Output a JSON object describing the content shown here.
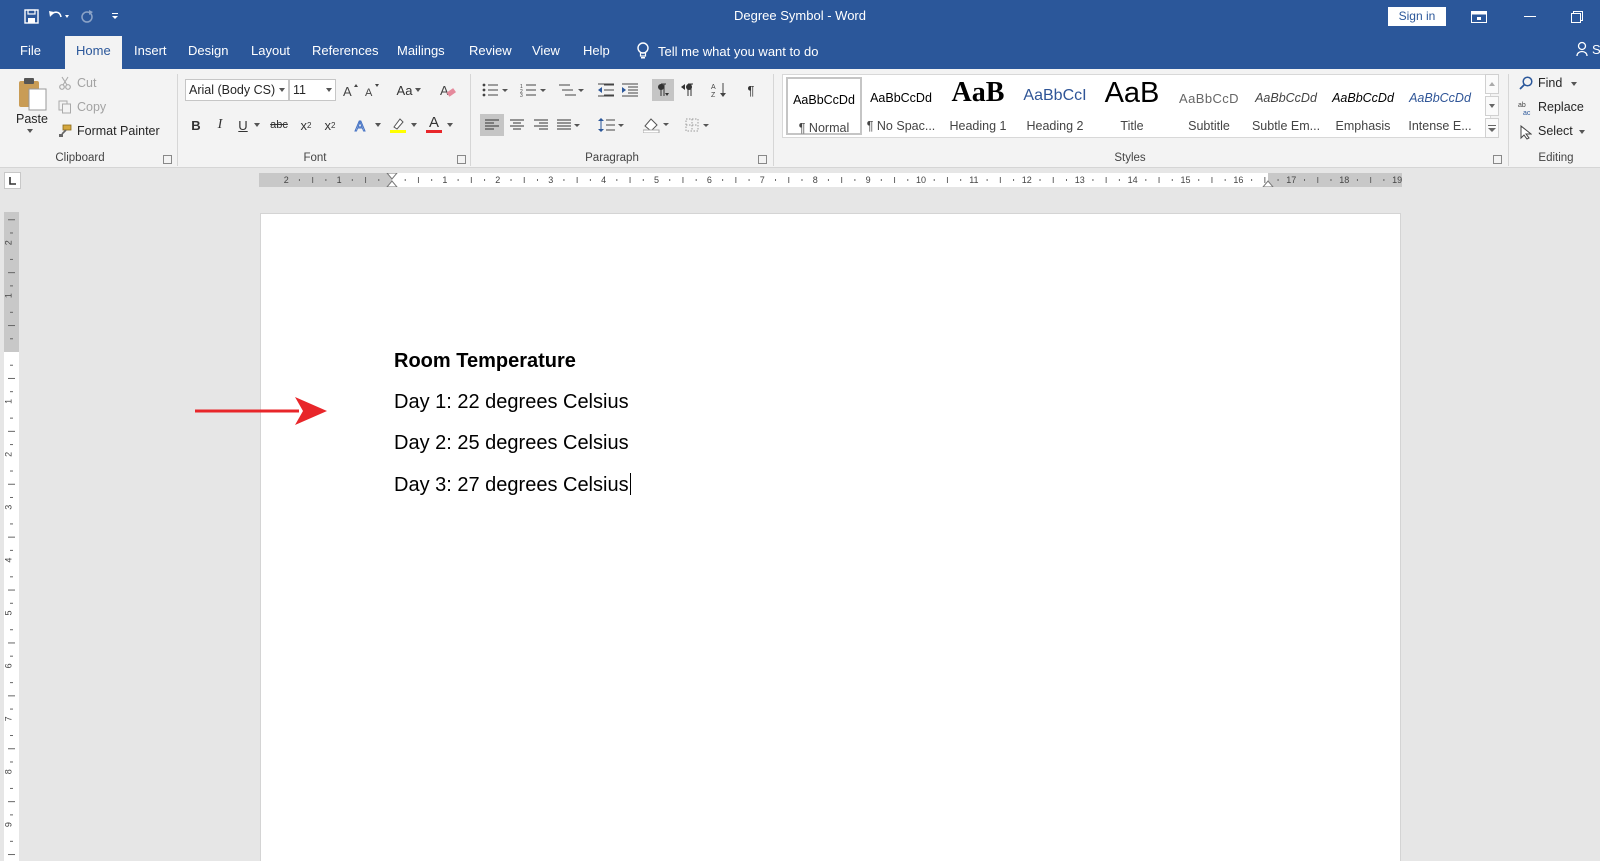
{
  "title_bar": {
    "document_name": "Degree Symbol",
    "app_name": "Word",
    "sign_in": "Sign in",
    "quick_access": [
      "save-icon",
      "undo-icon",
      "redo-icon",
      "customize-icon"
    ]
  },
  "tabs": [
    "File",
    "Home",
    "Insert",
    "Design",
    "Layout",
    "References",
    "Mailings",
    "Review",
    "View",
    "Help"
  ],
  "active_tab": "Home",
  "tell_me": "Tell me what you want to do",
  "share_partial": "S",
  "clipboard": {
    "paste": "Paste",
    "cut": "Cut",
    "copy": "Copy",
    "format_painter": "Format Painter",
    "label": "Clipboard"
  },
  "font": {
    "name": "Arial (Body CS)",
    "size": "11",
    "change_case": "Aa",
    "bold": "B",
    "italic": "I",
    "underline": "U",
    "strikethrough": "abc",
    "subscript": "x",
    "subscript_mark": "2",
    "superscript": "x",
    "superscript_mark": "2",
    "font_color_glyph": "A",
    "label": "Font"
  },
  "paragraph": {
    "label": "Paragraph",
    "pilcrow": "¶"
  },
  "styles": {
    "label": "Styles",
    "items": [
      {
        "sample": "AaBbCcDd",
        "name": "¶ Normal"
      },
      {
        "sample": "AaBbCcDd",
        "name": "¶ No Spac..."
      },
      {
        "sample": "AaB",
        "name": "Heading 1"
      },
      {
        "sample": "AaBbCcI",
        "name": "Heading 2"
      },
      {
        "sample": "AaB",
        "name": "Title"
      },
      {
        "sample": "AaBbCcD",
        "name": "Subtitle"
      },
      {
        "sample": "AaBbCcDd",
        "name": "Subtle Em..."
      },
      {
        "sample": "AaBbCcDd",
        "name": "Emphasis"
      },
      {
        "sample": "AaBbCcDd",
        "name": "Intense E..."
      }
    ]
  },
  "editing": {
    "find": "Find",
    "replace": "Replace",
    "select": "Select",
    "label": "Editing"
  },
  "ruler": {
    "horizontal_left": [
      "2",
      "1"
    ],
    "horizontal_right": [
      "1",
      "2",
      "3",
      "4",
      "5",
      "6",
      "7",
      "8",
      "9",
      "10",
      "11",
      "12",
      "13",
      "14",
      "15",
      "16",
      "17",
      "18",
      "19"
    ],
    "vertical_top": [
      "2",
      "1"
    ],
    "vertical": [
      "1",
      "2",
      "3",
      "4",
      "5",
      "6",
      "7",
      "8",
      "9"
    ]
  },
  "document": {
    "heading": "Room Temperature",
    "lines": [
      "Day 1: 22 degrees Celsius",
      "Day 2: 25 degrees Celsius",
      "Day 3: 27 degrees Celsius"
    ]
  },
  "colors": {
    "title_bar": "#2b579a",
    "ribbon": "#f3f3f3",
    "annotation_arrow": "#e8262a",
    "workspace": "#e6e6e6"
  }
}
